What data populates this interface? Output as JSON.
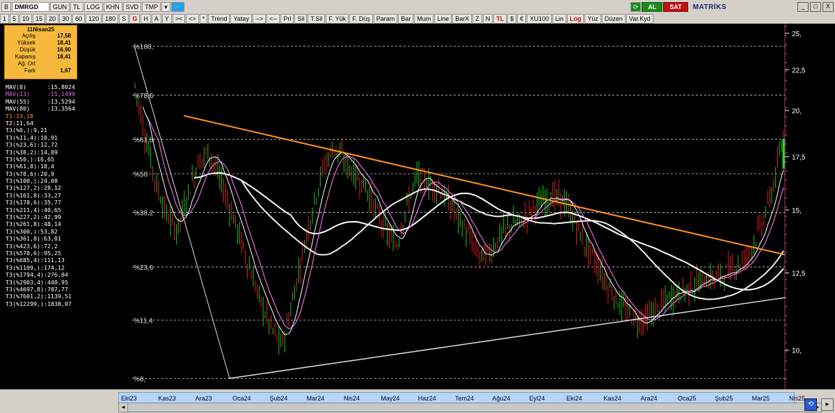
{
  "toolbar": {
    "row1": [
      {
        "label": "B",
        "style": ""
      },
      {
        "label": "DMRGD",
        "style": "sym"
      },
      {
        "label": "GUN",
        "style": ""
      },
      {
        "label": "TL",
        "style": ""
      },
      {
        "label": "LOG",
        "style": ""
      },
      {
        "label": "KHN",
        "style": ""
      },
      {
        "label": "SVD",
        "style": ""
      },
      {
        "label": "TMP",
        "style": ""
      }
    ],
    "row2_left": [
      "1",
      "5",
      "10",
      "15",
      "20",
      "30",
      "60",
      "120",
      "180",
      "S",
      "G",
      "H",
      "A",
      "Y"
    ],
    "row2_arrows": [
      ">< ",
      "<>",
      "*"
    ],
    "row2_tools": [
      "Trend",
      "Yatay",
      "-->",
      "<--",
      "Prl",
      "Sil",
      "T.Sil",
      "F. Yük",
      "F. Düş",
      "Param",
      "Bar",
      "Mum",
      "Line",
      "BarX",
      "Z",
      "N",
      "TL",
      "$",
      "€",
      "XU100",
      "Lin",
      "Log",
      "Yüz",
      "Düzen",
      "Var.Kyd"
    ],
    "al_label": "AL",
    "sat_label": "SAT",
    "brand": "MATRİKS",
    "window_controls": [
      "_",
      "□",
      "X"
    ]
  },
  "infobox": {
    "title": "11Nisan25",
    "rows": [
      {
        "label": "Açılış",
        "value": "17,58"
      },
      {
        "label": "Yüksek",
        "value": "18,41"
      },
      {
        "label": "Düşük",
        "value": "16,90"
      },
      {
        "label": "Kapanış",
        "value": "18,41"
      },
      {
        "label": "Ağ. Ort",
        "value": ""
      },
      {
        "label": "Fark",
        "value": "1,67"
      }
    ]
  },
  "legend": [
    {
      "text": "MAV(8)      :15,8024",
      "color": "#ffffff"
    },
    {
      "text": "MAV(13)     :15,1499",
      "color": "#e070e0"
    },
    {
      "text": "MAV(55)     :13,5294",
      "color": "#ffffff"
    },
    {
      "text": "MAV(80)     :13,3564",
      "color": "#ffffff"
    },
    {
      "text": "T1:13,18",
      "color": "#ff9020"
    },
    {
      "text": "T2:11,64",
      "color": "#ffffff"
    },
    {
      "text": "T3(%0,):9,21",
      "color": "#ffffff"
    },
    {
      "text": "T3(%11,4):10,91",
      "color": "#ffffff"
    },
    {
      "text": "T3(%23,6):12,72",
      "color": "#ffffff"
    },
    {
      "text": "T3(%38,2):14,89",
      "color": "#ffffff"
    },
    {
      "text": "T3(%50,):16,65",
      "color": "#ffffff"
    },
    {
      "text": "T3(%61,8):18,4",
      "color": "#ffffff"
    },
    {
      "text": "T3(%78,6):20,9",
      "color": "#ffffff"
    },
    {
      "text": "T3(%100,):24,08",
      "color": "#ffffff"
    },
    {
      "text": "T3(%127,2):28,12",
      "color": "#ffffff"
    },
    {
      "text": "T3(%161,8):33,27",
      "color": "#ffffff"
    },
    {
      "text": "T3(%178,6):35,77",
      "color": "#ffffff"
    },
    {
      "text": "T3(%211,4):40,65",
      "color": "#ffffff"
    },
    {
      "text": "T3(%227,2):42,99",
      "color": "#ffffff"
    },
    {
      "text": "T3(%261,8):48,14",
      "color": "#ffffff"
    },
    {
      "text": "T3(%300,):53,82",
      "color": "#ffffff"
    },
    {
      "text": "T3(%361,8):63,01",
      "color": "#ffffff"
    },
    {
      "text": "T3(%423,6):72,2",
      "color": "#ffffff"
    },
    {
      "text": "T3(%578,6):95,25",
      "color": "#ffffff"
    },
    {
      "text": "T3(%685,4):111,13",
      "color": "#ffffff"
    },
    {
      "text": "T3(%1109,):174,12",
      "color": "#ffffff"
    },
    {
      "text": "T3(%1794,4):276,04",
      "color": "#ffffff"
    },
    {
      "text": "T3(%2903,4):440,95",
      "color": "#ffffff"
    },
    {
      "text": "T3(%4697,8):707,77",
      "color": "#ffffff"
    },
    {
      "text": "T3(%7601,2):1139,51",
      "color": "#ffffff"
    },
    {
      "text": "T3(%12299,):1838,07",
      "color": "#ffffff"
    }
  ],
  "chart_data": {
    "type": "candlestick",
    "symbol": "DMRGD",
    "scale": "log",
    "yticks": [
      "25,",
      "22,5",
      "20,",
      "17,5",
      "15,",
      "12,5",
      "10,"
    ],
    "ytick_values": [
      25,
      22.5,
      20,
      17.5,
      15,
      12.5,
      10
    ],
    "ylim": [
      9.0,
      25.5
    ],
    "fib_levels": [
      {
        "label": "%100,",
        "value": 24.08
      },
      {
        "label": "%78,6",
        "value": 20.9
      },
      {
        "label": "%61,8",
        "value": 18.4
      },
      {
        "label": "%50",
        "value": 16.65
      },
      {
        "label": "%38,2",
        "value": 14.89
      },
      {
        "label": "%23,6",
        "value": 12.72
      },
      {
        "label": "%11,4",
        "value": 10.91
      },
      {
        "label": "%0,",
        "value": 9.21
      }
    ],
    "x_labels": [
      "Eki23",
      "Kas23",
      "Ara23",
      "Oca24",
      "Şub24",
      "Mar24",
      "Nis24",
      "May24",
      "Haz24",
      "Tem24",
      "Ağu24",
      "Eyl24",
      "Eki24",
      "Kas24",
      "Ara24",
      "Oca25",
      "Şub25",
      "Mar25",
      "Nis25"
    ],
    "close_series": [
      21.5,
      18.5,
      16.2,
      14.8,
      14.1,
      15.6,
      17.2,
      17.8,
      16.6,
      15.2,
      13.9,
      12.6,
      11.5,
      10.7,
      10.1,
      11.4,
      13.2,
      15.1,
      17.0,
      18.0,
      17.3,
      16.6,
      16.1,
      15.0,
      14.1,
      13.5,
      15.2,
      16.6,
      16.2,
      16.0,
      15.3,
      14.6,
      13.8,
      13.1,
      13.3,
      14.0,
      14.4,
      14.5,
      15.1,
      15.4,
      15.6,
      15.4,
      14.5,
      13.6,
      12.9,
      12.2,
      11.6,
      11.2,
      10.9,
      11.0,
      11.3,
      11.6,
      11.8,
      12.0,
      12.2,
      12.3,
      12.4,
      12.7,
      12.9,
      13.5,
      14.5,
      16.0,
      18.41
    ],
    "mav8_last": 15.8024,
    "mav13_last": 15.1499,
    "mav55_last": 13.5294,
    "mav80_last": 13.3564,
    "trend_T1": {
      "label": "T1",
      "start_value": 19.7,
      "end_value": 13.18
    },
    "trend_T2": {
      "label": "T2",
      "start_value": 9.21,
      "end_value": 11.64
    },
    "swing_line": {
      "high": 24.08,
      "low": 9.21
    }
  }
}
